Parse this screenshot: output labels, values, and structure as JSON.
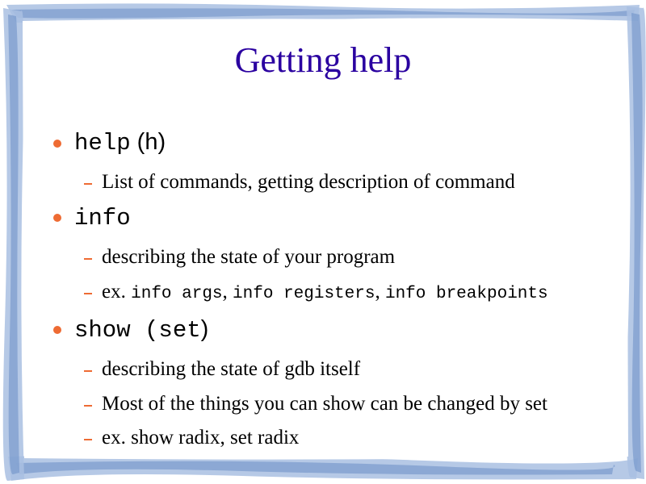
{
  "slide": {
    "title": "Getting help",
    "accent_color": "#ee6b33",
    "title_color": "#2a00a0",
    "frame_color": "#7d9fd0"
  },
  "items": [
    {
      "code": "help",
      "suffix_code": "",
      "suffix_text": " (h)",
      "subitems": [
        {
          "text": "List of commands, getting description of command"
        }
      ]
    },
    {
      "code": "info",
      "suffix_code": "",
      "suffix_text": "",
      "subitems": [
        {
          "text": "describing the state of your program"
        },
        {
          "prefix": "ex. ",
          "code1": "info args",
          "sep1": ", ",
          "code2": "info registers",
          "sep2": ", ",
          "code3": "info breakpoints"
        }
      ]
    },
    {
      "code": "show",
      "suffix_code": " (set",
      "suffix_text": ")",
      "subitems": [
        {
          "text": "describing the state of gdb itself"
        },
        {
          "text": "Most of the things you can show can be changed by set"
        },
        {
          "text": "ex. show radix, set radix"
        }
      ]
    }
  ]
}
